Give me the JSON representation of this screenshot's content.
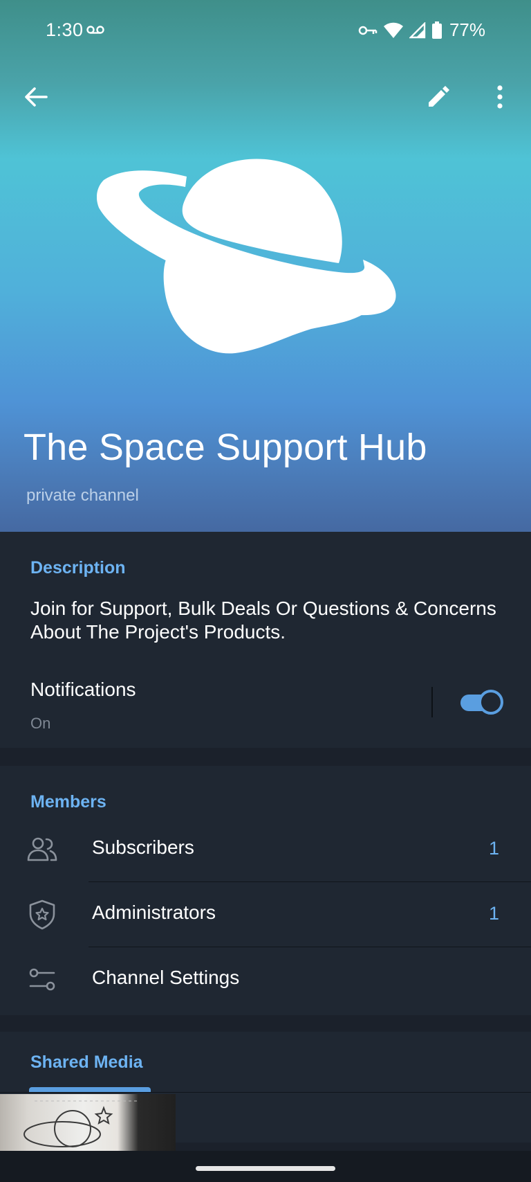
{
  "status_bar": {
    "time": "1:30",
    "battery": "77%",
    "icons": [
      "voicemail-icon",
      "vpn-key-icon",
      "wifi-icon",
      "signal-icon",
      "battery-icon"
    ]
  },
  "toolbar": {
    "back_icon": "arrow-left-icon",
    "edit_icon": "pencil-icon",
    "more_icon": "more-vertical-icon"
  },
  "channel": {
    "title": "The Space Support Hub",
    "subtitle": "private channel",
    "avatar_icon": "planet-icon"
  },
  "description": {
    "heading": "Description",
    "text": "Join for Support, Bulk Deals Or Questions & Concerns About The Project's Products."
  },
  "notifications": {
    "label": "Notifications",
    "value": "On",
    "enabled": true
  },
  "members": {
    "heading": "Members",
    "rows": [
      {
        "label": "Subscribers",
        "count": "1",
        "icon": "people-icon"
      },
      {
        "label": "Administrators",
        "count": "1",
        "icon": "shield-star-icon"
      },
      {
        "label": "Channel Settings",
        "count": "",
        "icon": "sliders-icon"
      }
    ]
  },
  "shared_media": {
    "heading": "Shared Media"
  },
  "colors": {
    "accent": "#6db3f2",
    "toggle": "#5a9ee0",
    "panel": "#1f2732",
    "background": "#1b212b"
  }
}
